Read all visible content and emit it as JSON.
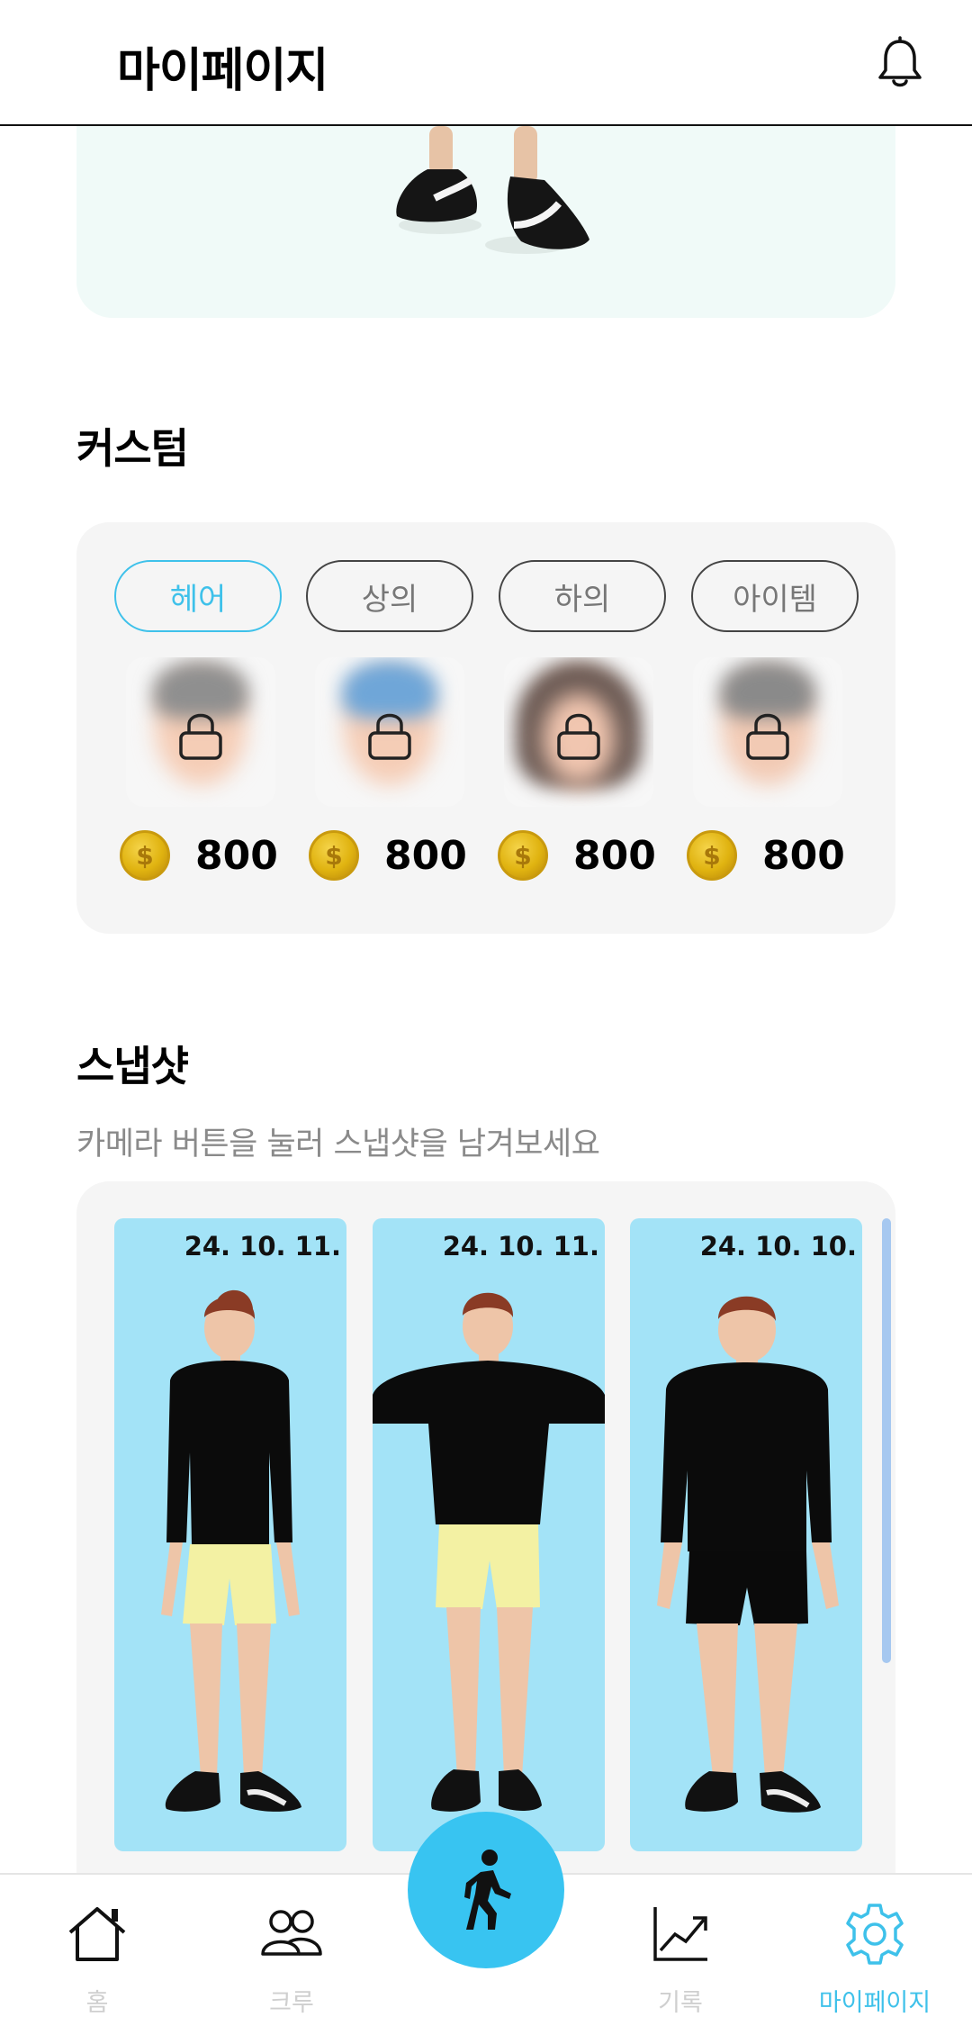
{
  "header": {
    "title": "마이페이지",
    "notification_icon": "bell-icon"
  },
  "custom": {
    "title": "커스텀",
    "tabs": [
      {
        "label": "헤어",
        "active": true
      },
      {
        "label": "상의",
        "active": false
      },
      {
        "label": "하의",
        "active": false
      },
      {
        "label": "아이템",
        "active": false
      }
    ],
    "items": [
      {
        "price": "800",
        "locked": true,
        "hair_color": "#8f8f8f"
      },
      {
        "price": "800",
        "locked": true,
        "hair_color": "#6fa6d8"
      },
      {
        "price": "800",
        "locked": true,
        "hair_color": "#6b5a54"
      },
      {
        "price": "800",
        "locked": true,
        "hair_color": "#8a8a8a"
      }
    ],
    "coin_symbol": "$"
  },
  "snapshot": {
    "title": "스냅샷",
    "subtitle": "카메라 버튼을 눌러 스냅샷을 남겨보세요",
    "cards": [
      {
        "date": "24. 10. 11.",
        "shorts_color": "#f3f1a3"
      },
      {
        "date": "24. 10. 11.",
        "shorts_color": "#f3f1a3"
      },
      {
        "date": "24. 10. 10.",
        "shorts_color": "#0a0a0a"
      }
    ]
  },
  "bottom_nav": {
    "items": [
      {
        "label": "홈",
        "icon": "home-icon",
        "active": false
      },
      {
        "label": "크루",
        "icon": "crew-icon",
        "active": false
      },
      {
        "label": "기록",
        "icon": "chart-icon",
        "active": false
      },
      {
        "label": "마이페이지",
        "icon": "gear-icon",
        "active": true
      }
    ],
    "fab_icon": "walking-person-icon"
  },
  "colors": {
    "accent": "#38c4f1",
    "card_bg": "#f5f5f5",
    "snapshot_bg": "#a3e3f7"
  }
}
